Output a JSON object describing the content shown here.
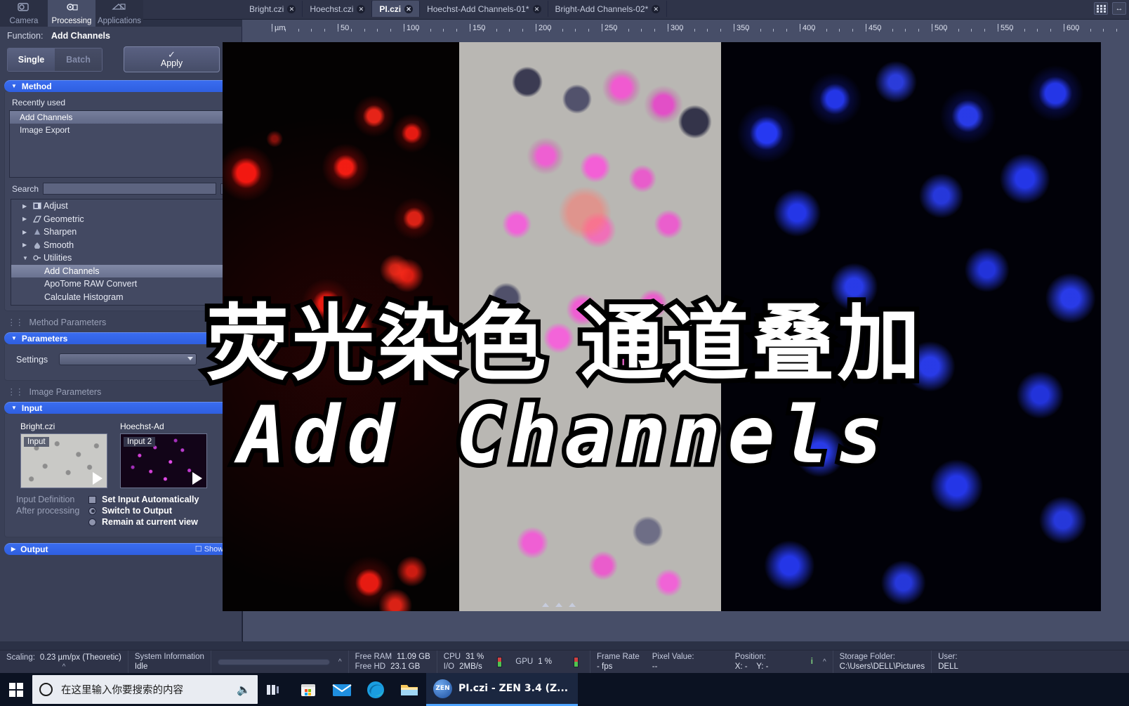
{
  "app_modes": [
    {
      "label": "Camera",
      "icon": "camera-icon",
      "active": false
    },
    {
      "label": "Processing",
      "icon": "gear-icon",
      "active": true
    },
    {
      "label": "Applications",
      "icon": "apps-icon",
      "active": false
    }
  ],
  "document_tabs": [
    {
      "label": "Bright.czi",
      "active": false
    },
    {
      "label": "Hoechst.czi",
      "active": false
    },
    {
      "label": "PI.czi",
      "active": true
    },
    {
      "label": "Hoechst-Add Channels-01*",
      "active": false
    },
    {
      "label": "Bright-Add Channels-02*",
      "active": false
    }
  ],
  "top_right_icons": [
    "grid-view-icon",
    "arrows-horizontal-icon"
  ],
  "function_bar": {
    "label": "Function:",
    "name": "Add Channels",
    "single_label": "Single",
    "batch_label": "Batch",
    "apply_label": "Apply",
    "apply_check": "✓"
  },
  "method": {
    "header": "Method",
    "recently_used_label": "Recently used",
    "recent_items": [
      {
        "label": "Add Channels",
        "selected": true
      },
      {
        "label": "Image Export",
        "selected": false
      }
    ],
    "search_label": "Search",
    "search_value": "",
    "search_placeholder": "",
    "clear_label": "x",
    "tree": [
      {
        "label": "Adjust",
        "icon": "adjust-icon",
        "expanded": false,
        "child": false,
        "selected": false
      },
      {
        "label": "Geometric",
        "icon": "geometric-icon",
        "expanded": false,
        "child": false,
        "selected": false
      },
      {
        "label": "Sharpen",
        "icon": "sharpen-icon",
        "expanded": false,
        "child": false,
        "selected": false
      },
      {
        "label": "Smooth",
        "icon": "smooth-icon",
        "expanded": false,
        "child": false,
        "selected": false
      },
      {
        "label": "Utilities",
        "icon": "utilities-icon",
        "expanded": true,
        "child": false,
        "selected": false
      },
      {
        "label": "Add Channels",
        "icon": "",
        "expanded": false,
        "child": true,
        "selected": true
      },
      {
        "label": "ApoTome RAW Convert",
        "icon": "",
        "expanded": false,
        "child": true,
        "selected": false
      },
      {
        "label": "Calculate Histogram",
        "icon": "",
        "expanded": false,
        "child": true,
        "selected": false
      }
    ]
  },
  "method_parameters": {
    "group_title": "Method Parameters",
    "header": "Parameters",
    "settings_label": "Settings",
    "settings_value": ""
  },
  "image_parameters": {
    "group_title": "Image Parameters",
    "input_header": "Input",
    "thumbs": [
      {
        "caption": "Bright.czi",
        "tag": "Input"
      },
      {
        "caption": "Hoechst-Ad",
        "tag": "Input 2"
      }
    ],
    "input_definition_label": "Input Definition",
    "set_input_automatically": "Set Input Automatically",
    "set_input_automatically_checked": false,
    "after_processing_label": "After processing",
    "switch_to_output": "Switch to Output",
    "remain_at_current_view": "Remain at current view",
    "after_processing_selected": "Switch to Output",
    "output_header": "Output",
    "output_show_all": "Show A"
  },
  "ruler": {
    "unit": "µm",
    "ticks": [
      "50",
      "100",
      "150",
      "200",
      "250",
      "300",
      "350",
      "400",
      "450",
      "500",
      "550",
      "600"
    ]
  },
  "caption_overlay": {
    "chinese": "荧光染色  通道叠加",
    "english": "Add Channels"
  },
  "status_bar": {
    "scaling_label": "Scaling:",
    "scaling_value": "0.23 µm/px (Theoretic)",
    "system_information_label": "System Information",
    "system_information_value": "Idle",
    "free_ram_label": "Free RAM",
    "free_ram_value": "11.09 GB",
    "free_hd_label": "Free HD",
    "free_hd_value": "23.1 GB",
    "cpu_label": "CPU",
    "cpu_value": "31 %",
    "io_label": "I/O",
    "io_value": "2MB/s",
    "gpu_label": "GPU",
    "gpu_value": "1 %",
    "frame_rate_label": "Frame Rate",
    "frame_rate_value": "- fps",
    "pixel_value_label": "Pixel Value:",
    "pixel_value_value": "--",
    "position_label": "Position:",
    "position_x": "X: -",
    "position_y": "Y: -",
    "storage_folder_label": "Storage Folder:",
    "storage_folder_value": "C:\\Users\\DELL\\Pictures",
    "user_label": "User:",
    "user_value": "DELL"
  },
  "taskbar": {
    "start_icon": "windows-logo-icon",
    "search_placeholder": "在这里输入你要搜索的内容",
    "search_circle_icon": "cortana-circle-icon",
    "mic_icon": "microphone-icon",
    "taskview_icon": "task-view-icon",
    "pinned": [
      {
        "name": "microsoft-store-icon"
      },
      {
        "name": "mail-icon"
      },
      {
        "name": "edge-icon"
      },
      {
        "name": "file-explorer-icon"
      }
    ],
    "active_window": "PI.czi - ZEN 3.4 (Z...",
    "active_window_icon": "zen-icon"
  },
  "colors": {
    "accent_blue": "#3a6df0",
    "panel_bg": "#3a4057",
    "window_bg": "#2f3449",
    "taskbar_bg": "#0b1222",
    "selection": "#767e9c",
    "pi_red": "#ff1e14",
    "hoechst_blue": "#283cff",
    "overlay_magenta": "#f05ad0"
  }
}
